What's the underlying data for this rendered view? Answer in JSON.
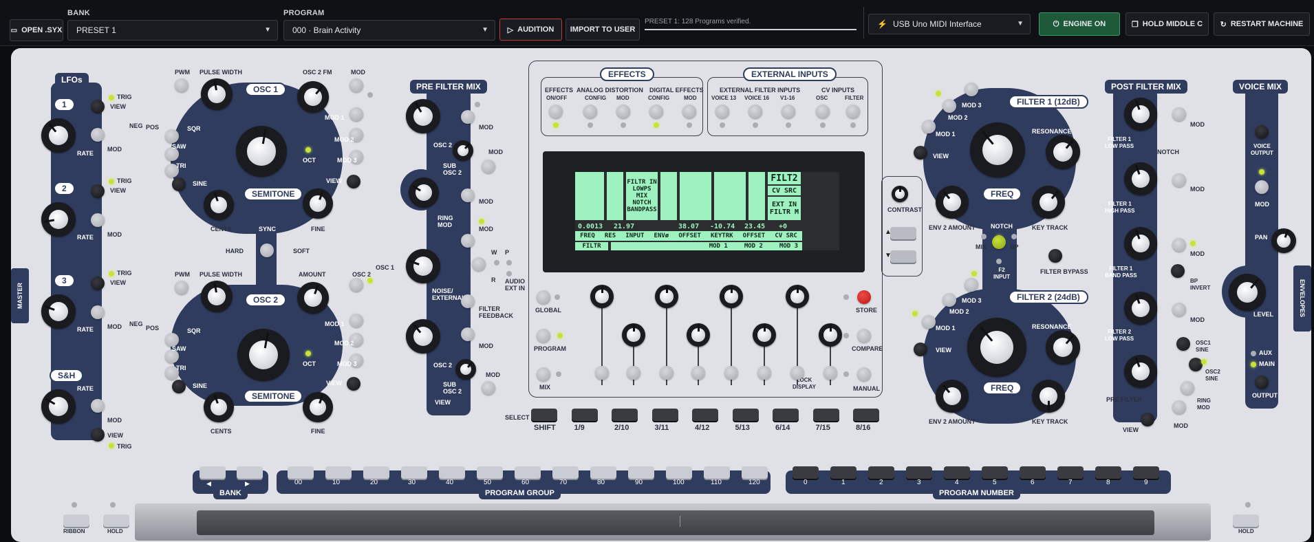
{
  "topbar": {
    "open_syx": "OPEN .SYX",
    "bank_label": "BANK",
    "bank_value": "PRESET 1",
    "program_label": "PROGRAM",
    "program_value": "000 · Brain Activity",
    "audition": "AUDITION",
    "import": "IMPORT TO USER",
    "status": "PRESET 1: 128 Programs verified.",
    "midi_interface": "USB Uno MIDI Interface",
    "engine": "ENGINE ON",
    "hold_middle_c": "HOLD MIDDLE C",
    "restart": "RESTART MACHINE"
  },
  "colors": {
    "accent": "#2f3c5e",
    "led_on": "#c8e23a",
    "engine_green": "#1e5a3a",
    "audition_red": "#c23a3a",
    "lcd_green": "#9ef2c0"
  },
  "lfos": {
    "title": "LFOs",
    "n1": "1",
    "n2": "2",
    "n3": "3",
    "sh": "S&H",
    "trig": "TRIG",
    "view": "VIEW",
    "rate": "RATE",
    "mod": "MOD",
    "neg": "NEG",
    "pos": "POS"
  },
  "osc1": {
    "title": "OSC 1",
    "pwm": "PWM",
    "pulse_width": "PULSE WIDTH",
    "osc2fm": "OSC 2 FM",
    "mod": "MOD",
    "sqr": "SQR",
    "saw": "SAW",
    "tri": "TRI",
    "sine": "SINE",
    "oct": "OCT",
    "mod1": "MOD 1",
    "mod2": "MOD 2",
    "mod3": "MOD 3",
    "view": "VIEW",
    "semitone": "SEMITONE",
    "cents": "CENTS",
    "fine": "FINE"
  },
  "sync": {
    "sync": "SYNC",
    "hard": "HARD",
    "soft": "SOFT"
  },
  "osc2": {
    "title": "OSC 2",
    "pwm": "PWM",
    "pulse_width": "PULSE WIDTH",
    "amount": "AMOUNT",
    "osc2": "OSC 2",
    "osc1": "OSC 1",
    "sqr": "SQR",
    "saw": "SAW",
    "tri": "TRI",
    "sine": "SINE",
    "oct": "OCT",
    "mod1": "MOD 1",
    "mod2": "MOD 2",
    "mod3": "MOD 3",
    "view": "VIEW",
    "semitone": "SEMITONE",
    "cents": "CENTS",
    "fine": "FINE"
  },
  "prefilter": {
    "title": "PRE FILTER MIX",
    "osc2": "OSC 2",
    "sub_osc2": "SUB\nOSC 2",
    "ring_mod": "RING\nMOD",
    "noise": "NOISE/\nEXTERNAL",
    "mod": "MOD",
    "w": "W",
    "p": "P",
    "r": "R",
    "audio_ext_in": "AUDIO\nEXT IN",
    "filter_feedback": "FILTER\nFEEDBACK",
    "view": "VIEW"
  },
  "effects": {
    "title": "EFFECTS",
    "effects": "EFFECTS",
    "on_off": "ON/OFF",
    "analog": "ANALOG DISTORTION",
    "config": "CONFIG",
    "mod": "MOD",
    "digital": "DIGITAL EFFECTS"
  },
  "external": {
    "title": "EXTERNAL INPUTS",
    "ext_filter": "EXTERNAL FILTER INPUTS",
    "cv_inputs": "CV INPUTS",
    "voice13": "VOICE 13",
    "voice16": "VOICE 16",
    "v116": "V1-16",
    "osc": "OSC",
    "filter": "FILTER"
  },
  "lcd": {
    "tabs": [
      "FREQ",
      "RES",
      "INPUT",
      "ENVø",
      "OFFSET",
      "KEYTRK",
      "OFFSET",
      "CV SRC"
    ],
    "values": [
      "0.0013",
      "21.97",
      "",
      "38.07",
      "-10.74",
      "23.45",
      "+0",
      ""
    ],
    "filt2": "FILT2",
    "filter_in": "FILTR IN",
    "modes": [
      "LOWPS",
      "MIX",
      "NOTCH",
      "BANDPASS"
    ],
    "cv_src": "CV SRC",
    "ext_in": "EXT IN",
    "filtr_m": "FILTR M",
    "bottom_left": "FILTR",
    "mod1": "MOD 1",
    "mod2": "MOD 2",
    "mod3": "MOD 3"
  },
  "program_section": {
    "contrast": "CONTRAST",
    "global": "GLOBAL",
    "program": "PROGRAM",
    "mix": "MIX",
    "store": "STORE",
    "compare": "COMPARE",
    "manual": "MANUAL",
    "lock_display": "LOCK\nDISPLAY",
    "select": "SELECT",
    "select_keys": [
      "SHIFT",
      "1/9",
      "2/10",
      "3/11",
      "4/12",
      "5/13",
      "6/14",
      "7/15",
      "8/16"
    ]
  },
  "filter1": {
    "title": "FILTER 1 (12dB)",
    "mod1": "MOD 1",
    "mod2": "MOD 2",
    "mod3": "MOD 3",
    "view": "VIEW",
    "resonance": "RESONANCE",
    "freq": "FREQ",
    "env2": "ENV 2 AMOUNT",
    "key_track": "KEY TRACK"
  },
  "notch": {
    "notch": "NOTCH",
    "mix": "MIX",
    "bp": "BP",
    "f2_input": "F2\nINPUT",
    "filter_bypass": "FILTER BYPASS"
  },
  "filter2": {
    "title": "FILTER 2 (24dB)",
    "mod1": "MOD 1",
    "mod2": "MOD 2",
    "mod3": "MOD 3",
    "view": "VIEW",
    "resonance": "RESONANCE",
    "freq": "FREQ",
    "env2": "ENV 2 AMOUNT",
    "key_track": "KEY TRACK"
  },
  "postfilter": {
    "title": "POST FILTER MIX",
    "f1lp": "FILTER 1\nLOW PASS",
    "f1hp": "FILTER 1\nHIGH PASS",
    "f1bp": "FILTER 1\nBAND PASS",
    "f2lp": "FILTER 2\nLOW PASS",
    "pre_filter": "PRE FILTER",
    "mod": "MOD",
    "notch": "NOTCH",
    "bp_invert": "BP\nINVERT",
    "osc1_sine": "OSC1\nSINE",
    "osc2_sine": "OSC2\nSINE",
    "ring_mod": "RING\nMOD",
    "view": "VIEW"
  },
  "voicemix": {
    "title": "VOICE MIX",
    "voice_output": "VOICE\nOUTPUT",
    "mod": "MOD",
    "pan": "PAN",
    "level": "LEVEL",
    "aux": "AUX",
    "main": "MAIN",
    "output": "OUTPUT"
  },
  "tabs": {
    "master": "MASTER",
    "envelopes": "ENVELOPES"
  },
  "bank_section": {
    "label": "BANK",
    "left": "◀",
    "right": "▶"
  },
  "program_group": {
    "label": "PROGRAM GROUP",
    "values": [
      "00",
      "10",
      "20",
      "30",
      "40",
      "50",
      "60",
      "70",
      "80",
      "90",
      "100",
      "110",
      "120"
    ]
  },
  "program_number": {
    "label": "PROGRAM NUMBER",
    "values": [
      "0",
      "1",
      "2",
      "3",
      "4",
      "5",
      "6",
      "7",
      "8",
      "9"
    ]
  },
  "ribbon": {
    "ribbon": "RIBBON",
    "hold_left": "HOLD",
    "hold_right": "HOLD"
  }
}
